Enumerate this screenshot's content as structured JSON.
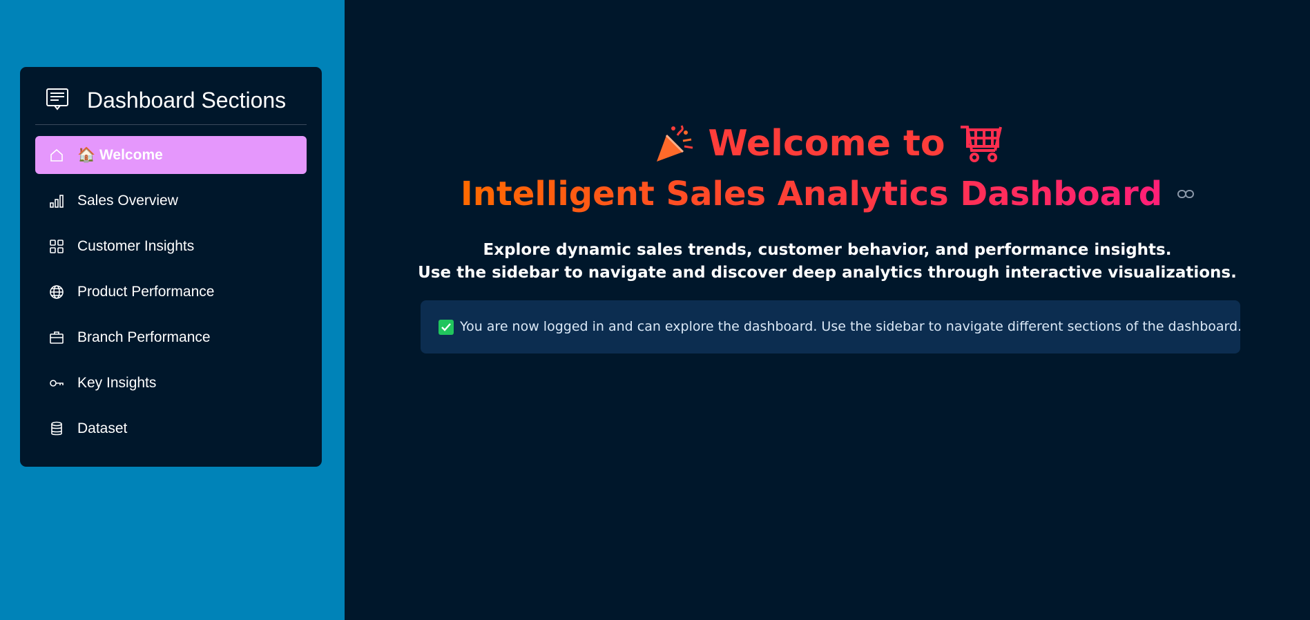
{
  "sidebar": {
    "header": {
      "icon": "menu-card-icon",
      "title": "Dashboard Sections"
    },
    "items": [
      {
        "label": "🏠 Welcome",
        "icon": "house-icon",
        "active": true
      },
      {
        "label": "Sales Overview",
        "icon": "bar-chart-icon",
        "active": false
      },
      {
        "label": "Customer Insights",
        "icon": "grid-icon",
        "active": false
      },
      {
        "label": "Product Performance",
        "icon": "globe-icon",
        "active": false
      },
      {
        "label": "Branch Performance",
        "icon": "briefcase-icon",
        "active": false
      },
      {
        "label": "Key Insights",
        "icon": "key-icon",
        "active": false
      },
      {
        "label": "Dataset",
        "icon": "database-icon",
        "active": false
      }
    ],
    "background": "#0083b8",
    "active_color": "#e597fc"
  },
  "main": {
    "hero_line1": "Welcome to",
    "hero_line1_icons": [
      "party-popper-icon",
      "shopping-cart-icon"
    ],
    "hero_line2": "Intelligent Sales Analytics Dashboard",
    "hero_line2_icon": "link-icon",
    "subtitle_line1": "Explore dynamic sales trends, customer behavior, and performance insights.",
    "subtitle_line2": "Use the sidebar to navigate and discover deep analytics through interactive visualizations.",
    "alert_icon": "check-icon",
    "alert_text": "You are now logged in and can explore the dashboard. Use the sidebar to navigate different sections of the dashboard.",
    "background": "#00172b",
    "accent": "#ff3d3a"
  }
}
